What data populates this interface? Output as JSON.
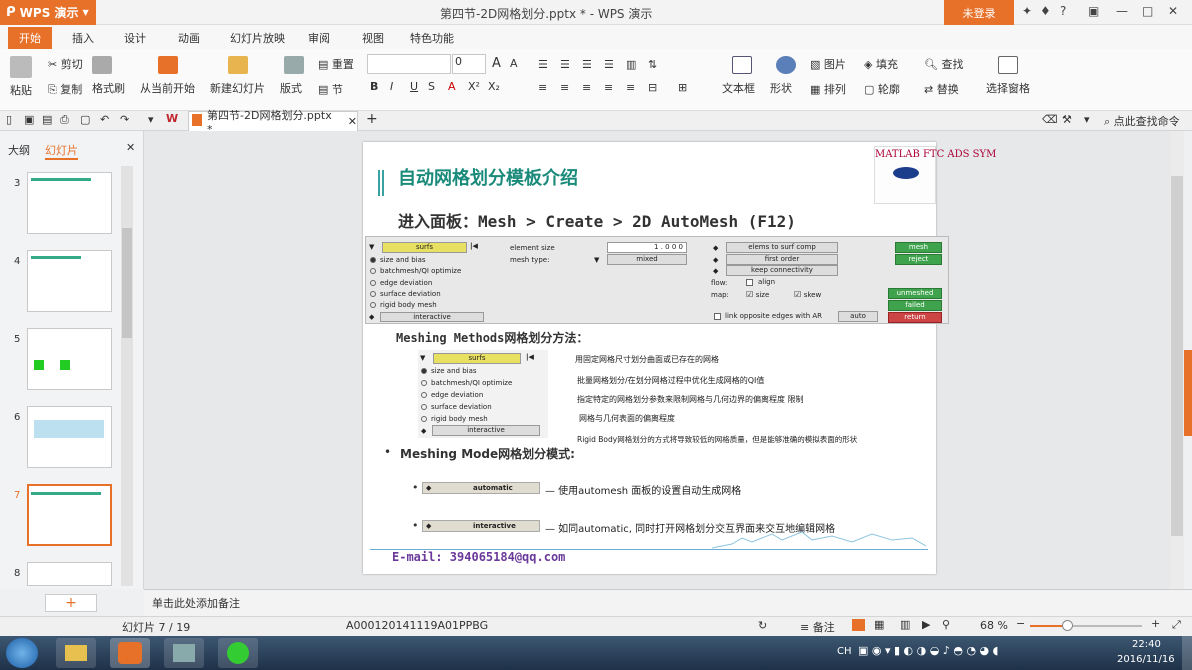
{
  "titlebar": {
    "app_label": "WPS 演示",
    "document_title": "第四节-2D网格划分.pptx * - WPS 演示",
    "login_label": "未登录"
  },
  "menu": {
    "tabs": [
      "开始",
      "插入",
      "设计",
      "动画",
      "幻灯片放映",
      "审阅",
      "视图",
      "特色功能"
    ]
  },
  "ribbon": {
    "paste": "粘贴",
    "cut": "剪切",
    "copy": "复制",
    "format_painter": "格式刷",
    "from_current": "从当前开始",
    "new_slide": "新建幻灯片",
    "layout": "版式",
    "reset": "重置",
    "section": "节",
    "font_size": "0",
    "text_box": "文本框",
    "shape": "形状",
    "picture": "图片",
    "fill": "填充",
    "arrange": "排列",
    "outline": "轮廓",
    "find": "查找",
    "replace": "替换",
    "select_pane": "选择窗格"
  },
  "tabstrip": {
    "doc_tab": "第四节-2D网格划分.pptx *",
    "search_cmd": "点此查找命令"
  },
  "leftpanel": {
    "tab_outline": "大纲",
    "tab_slides": "幻灯片",
    "thumb_numbers": [
      "3",
      "4",
      "5",
      "6",
      "7",
      "8"
    ],
    "selected": "7"
  },
  "slide": {
    "title": "自动网格划分模板介绍",
    "path_line": "进入面板：Mesh > Create > 2D AutoMesh (F12)",
    "logo_letters": "MATLAB FTC ADS SYM",
    "panel": {
      "surfs": "surfs",
      "options": [
        "size and bias",
        "batchmesh/QI optimize",
        "edge deviation",
        "surface deviation",
        "rigid body mesh"
      ],
      "interactive": "interactive",
      "element_size_label": "element size",
      "element_size_value": "1 . 0 0 0",
      "mesh_type_label": "mesh type:",
      "mesh_type_value": "mixed",
      "elems_to_surf": "elems to surf comp",
      "first_order": "first order",
      "keep_connectivity": "keep connectivity",
      "flow_label": "flow:",
      "align": "align",
      "map_label": "map:",
      "size": "size",
      "skew": "skew",
      "link_opposite": "link opposite edges with AR",
      "auto": "auto",
      "mesh": "mesh",
      "reject": "reject",
      "unmeshed": "unmeshed",
      "failed": "failed",
      "return": "return"
    },
    "meshing_methods_heading": "Meshing Methods网格划分方法：",
    "descriptions": [
      "用固定网格尺寸划分曲面或已存在的网格",
      "批量网格划分/在划分网格过程中优化生成网格的QI值",
      "指定特定的网格划分参数来限制网格与几何边界的偏离程度 限制",
      "网格与几何表面的偏离程度",
      "Rigid Body网格划分的方式将导致较低的网格质量，但是能够准确的模拟表面的形状"
    ],
    "meshing_mode_heading": "Meshing Mode网格划分模式:",
    "automatic_label": "automatic",
    "automatic_desc": "— 使用automesh 面板的设置自动生成网格",
    "interactive_label": "interactive",
    "interactive_desc": "— 如同automatic, 同时打开网格划分交互界面来交互地编辑网格",
    "email": "E-mail: 394065184@qq.com"
  },
  "notes": {
    "placeholder": "单击此处添加备注"
  },
  "statusbar": {
    "slide_counter": "幻灯片 7 / 19",
    "template_id": "A000120141119A01PPBG",
    "notes_label": "备注",
    "zoom": "68 %"
  },
  "taskbar": {
    "lang": "CH",
    "time": "22:40",
    "date": "2016/11/16"
  },
  "colors": {
    "accent": "#e8712a",
    "slide_title": "#1a8a7a",
    "email": "#6a3a9a"
  }
}
